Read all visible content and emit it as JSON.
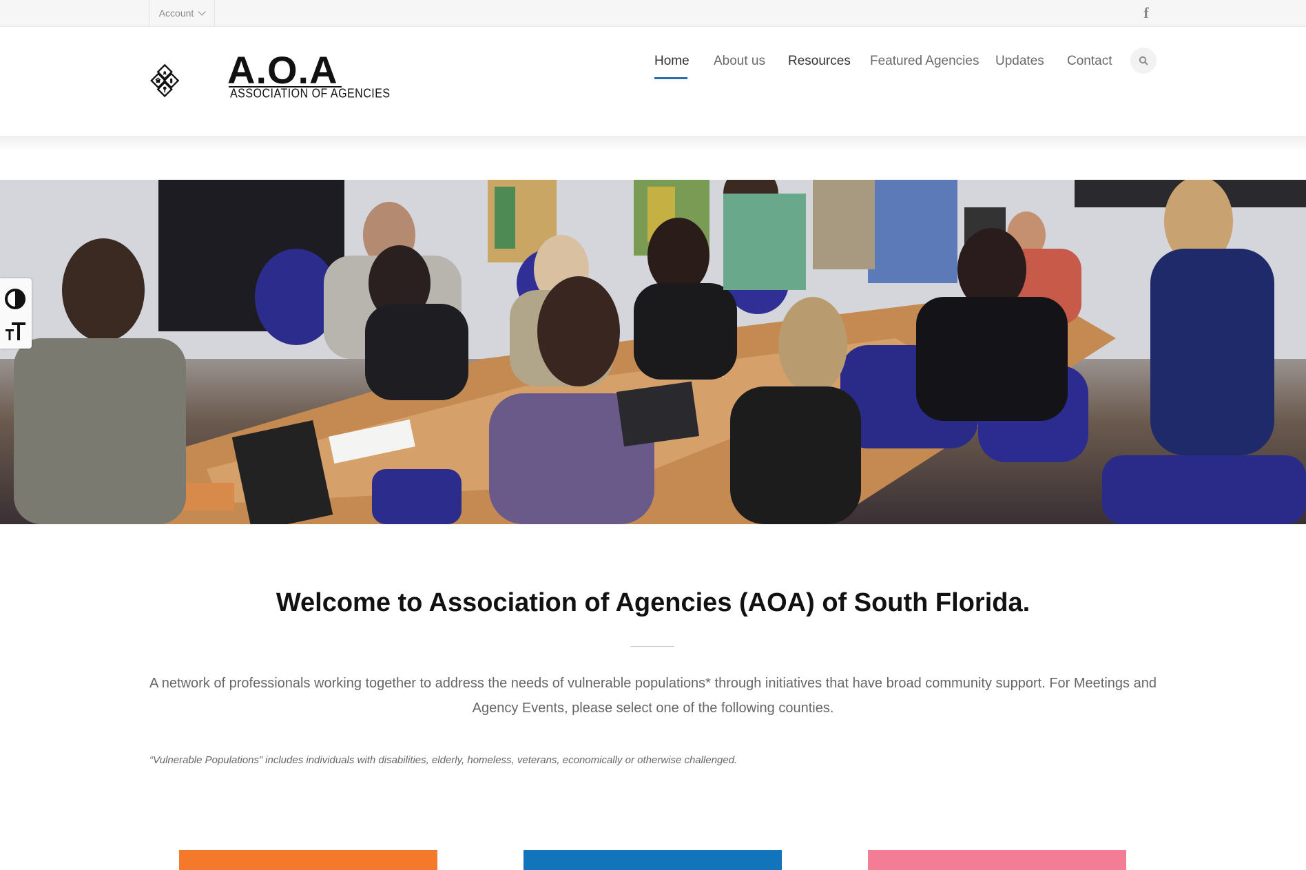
{
  "topbar": {
    "account_label": "Account",
    "social_icon": "facebook-icon"
  },
  "logo": {
    "title": "A.O.A",
    "subtitle": "ASSOCIATION OF AGENCIES"
  },
  "nav": {
    "items": [
      {
        "label": "Home",
        "active": true
      },
      {
        "label": "About us"
      },
      {
        "label": "Resources"
      },
      {
        "label": "Featured Agencies"
      },
      {
        "label": "Updates"
      },
      {
        "label": "Contact"
      }
    ],
    "search_icon": "search-icon",
    "accent": "#2a6fa8"
  },
  "accessibility": {
    "contrast_icon": "contrast-icon",
    "font_size_icon": "text-size-icon"
  },
  "main": {
    "welcome": "Welcome to Association of Agencies (AOA) of South Florida.",
    "intro": "A network of professionals working together to address the needs of vulnerable populations* through initiatives that have broad community support. For Meetings and Agency Events, please select one of the following counties.",
    "note": "“Vulnerable Populations” includes individuals with disabilities, elderly, homeless, veterans, economically or otherwise challenged."
  },
  "county_buttons": {
    "colors": [
      "#f5792a",
      "#1275bc",
      "#f47d96"
    ]
  }
}
